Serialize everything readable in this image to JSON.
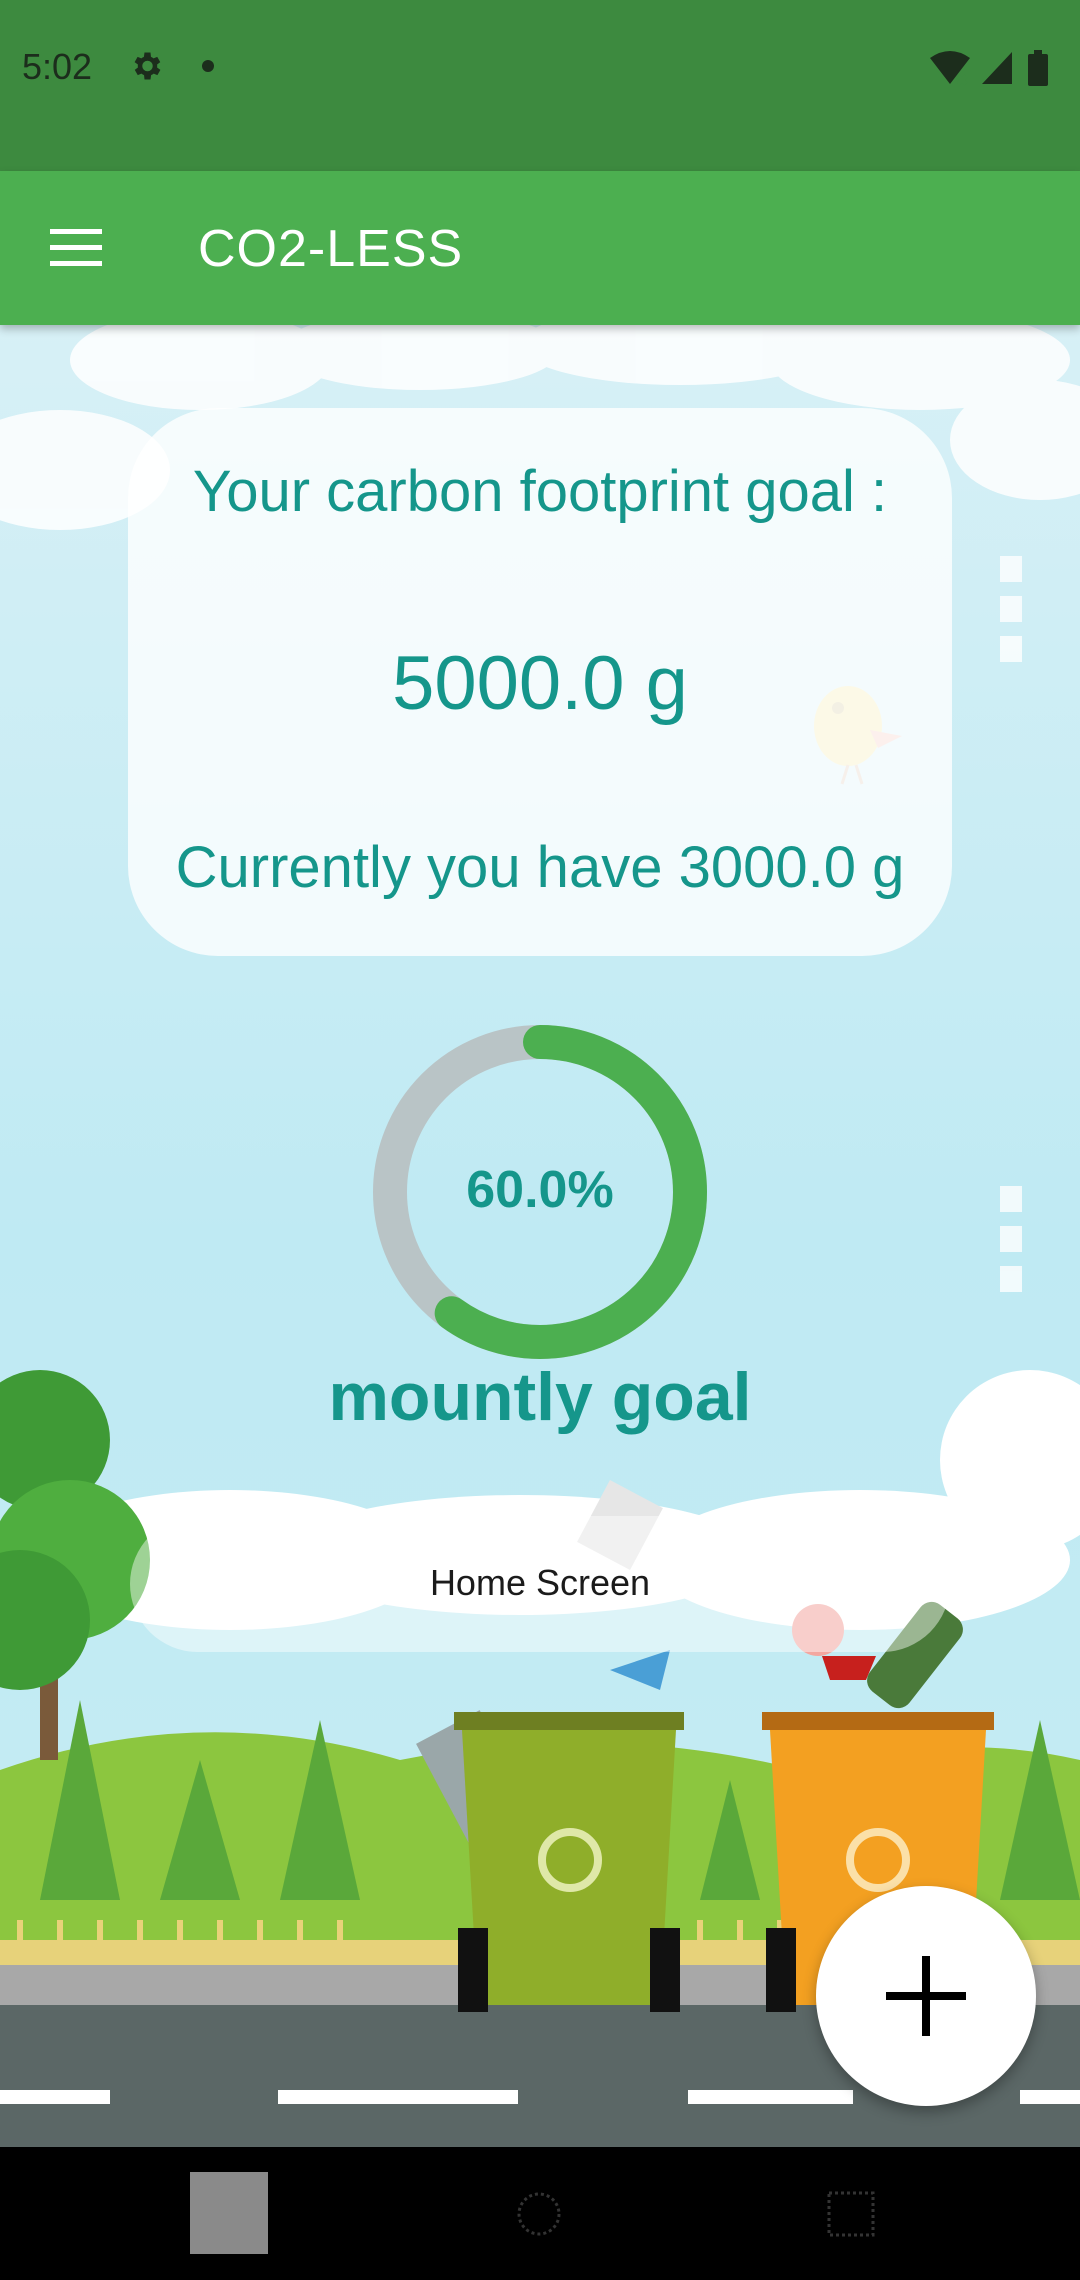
{
  "status_bar": {
    "time": "5:02",
    "icons": [
      "gear-icon",
      "dot-icon",
      "wifi-icon",
      "signal-icon",
      "battery-icon"
    ]
  },
  "app_bar": {
    "title": "CO2-LESS",
    "menu_icon": "hamburger-menu-icon"
  },
  "goal_card": {
    "title": "Your carbon footprint goal :",
    "value": "5000.0 g",
    "current": "Currently you have 3000.0 g"
  },
  "progress": {
    "label": "60.0%",
    "fraction": 0.6,
    "caption": "mountly goal"
  },
  "home_label": "Home Screen",
  "fab": {
    "icon": "plus-icon"
  },
  "colors": {
    "status_bar": "#3d8a3f",
    "app_bar": "#4caf50",
    "accent_text": "#15968b",
    "ring_fill": "#4caf50",
    "ring_track": "#b9c4c6"
  },
  "nav_bar": {
    "buttons": [
      "back-icon",
      "home-icon",
      "recent-apps-icon"
    ]
  }
}
